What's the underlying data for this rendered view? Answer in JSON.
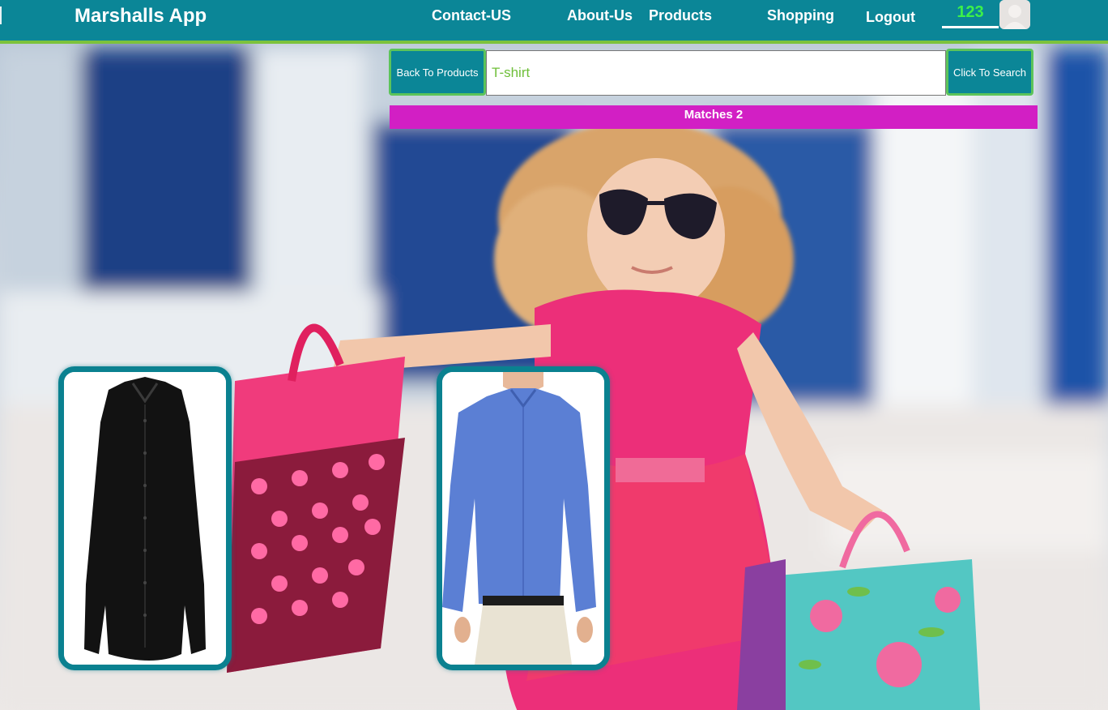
{
  "app": {
    "title": "Marshalls App"
  },
  "nav": {
    "contact": "Contact-US",
    "about": "About-Us",
    "products": "Products",
    "shopping": "Shopping",
    "logout": "Logout",
    "cart_count": "123"
  },
  "search": {
    "back_label": "Back To Products",
    "value": "T-shirt",
    "button_label": "Click To Search"
  },
  "results": {
    "matches_label": "Matches 2"
  },
  "products": [
    {
      "image": "black-long-sleeve-shirt"
    },
    {
      "image": "blue-button-down-shirt"
    }
  ],
  "colors": {
    "navbar": "#0b8697",
    "accent_green": "#7cc23c",
    "matches_bar": "#d21fc4",
    "cart_count": "#3cf04a"
  }
}
